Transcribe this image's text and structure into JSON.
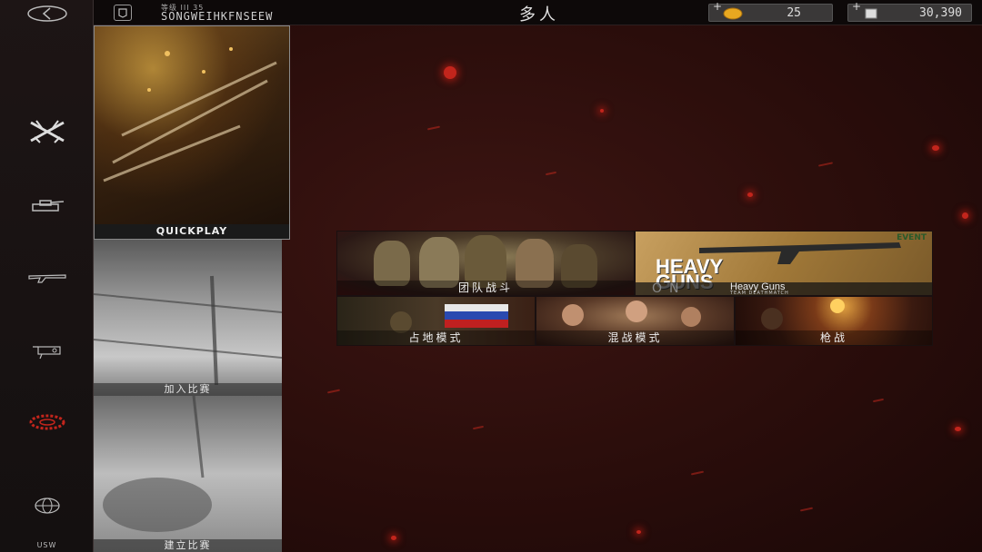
{
  "header": {
    "rank_label": "等级 III 35",
    "player_name": "SONGWEIHKFNSEEW",
    "screen_title": "多人",
    "currency_gold": {
      "value": "25",
      "plus": "+"
    },
    "currency_cash": {
      "value": "30,390",
      "plus": "+"
    }
  },
  "rail": {
    "bottom_label": "USW"
  },
  "modes": {
    "quickplay": "QUICKPLAY",
    "join_match": "加入比赛",
    "create_match": "建立比赛"
  },
  "game_modes": {
    "team_deathmatch": "团队战斗",
    "heavy_guns": {
      "big_title_line1": "HEAVY",
      "big_title_line2": "GUNS",
      "on_text": "ON",
      "name": "Heavy Guns",
      "subtitle": "TEAM DEATHMATCH",
      "corner_tag": "EVENT"
    },
    "conquest": "占地模式",
    "melee": "混战模式",
    "gunfight": "枪战"
  },
  "colors": {
    "accent_red": "#c2251c",
    "bg_dark": "#2a0f0d"
  }
}
